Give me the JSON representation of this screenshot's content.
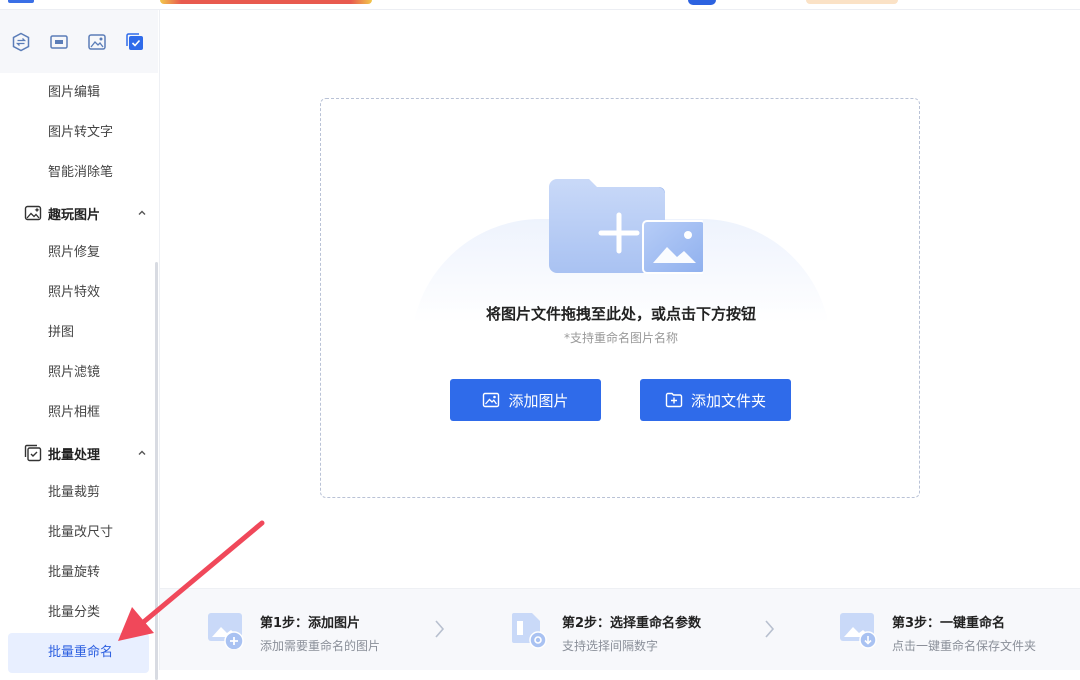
{
  "sidebar": {
    "top_icons": [
      "exchange-icon",
      "crop-icon",
      "image-magic-icon",
      "batch-check-icon"
    ],
    "items": [
      {
        "type": "sub",
        "label": "图片编辑"
      },
      {
        "type": "sub",
        "label": "图片转文字"
      },
      {
        "type": "sub",
        "label": "智能消除笔"
      },
      {
        "type": "group",
        "label": "趣玩图片",
        "icon": "fun-image-icon"
      },
      {
        "type": "sub",
        "label": "照片修复"
      },
      {
        "type": "sub",
        "label": "照片特效"
      },
      {
        "type": "sub",
        "label": "拼图"
      },
      {
        "type": "sub",
        "label": "照片滤镜"
      },
      {
        "type": "sub",
        "label": "照片相框"
      },
      {
        "type": "group",
        "label": "批量处理",
        "icon": "batch-icon"
      },
      {
        "type": "sub",
        "label": "批量裁剪"
      },
      {
        "type": "sub",
        "label": "批量改尺寸"
      },
      {
        "type": "sub",
        "label": "批量旋转"
      },
      {
        "type": "sub",
        "label": "批量分类"
      },
      {
        "type": "sub",
        "label": "批量重命名",
        "active": true
      }
    ]
  },
  "dropzone": {
    "title": "将图片文件拖拽至此处，或点击下方按钮",
    "subtitle": "*支持重命名图片名称",
    "add_image_label": "添加图片",
    "add_folder_label": "添加文件夹"
  },
  "steps": [
    {
      "title": "第1步：添加图片",
      "desc": "添加需要重命名的图片"
    },
    {
      "title": "第2步：选择重命名参数",
      "desc": "支持选择间隔数字"
    },
    {
      "title": "第3步：一键重命名",
      "desc": "点击一键重命名保存文件夹"
    }
  ],
  "colors": {
    "accent": "#2f6bea",
    "active_bg": "#e8efff",
    "annotation_arrow": "#f0485a"
  }
}
